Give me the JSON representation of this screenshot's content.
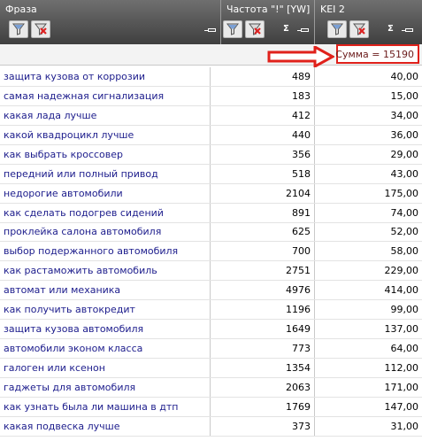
{
  "header": {
    "col_phrase": "Фраза",
    "col_freq": "Частота \"!\" [YW]",
    "col_kei": "KEI 2",
    "sigma": "Σ"
  },
  "summary": {
    "text": "Сумма = 15190"
  },
  "colors": {
    "header_bg": "#4f4f4f",
    "link": "#1c1c8c",
    "highlight": "#e0211b"
  },
  "rows": [
    {
      "phrase": "защита кузова от коррозии",
      "freq": "489",
      "kei": "40,00"
    },
    {
      "phrase": "самая надежная сигнализация",
      "freq": "183",
      "kei": "15,00"
    },
    {
      "phrase": "какая лада лучше",
      "freq": "412",
      "kei": "34,00"
    },
    {
      "phrase": "какой квадроцикл лучше",
      "freq": "440",
      "kei": "36,00"
    },
    {
      "phrase": "как выбрать кроссовер",
      "freq": "356",
      "kei": "29,00"
    },
    {
      "phrase": "передний или полный привод",
      "freq": "518",
      "kei": "43,00"
    },
    {
      "phrase": "недорогие автомобили",
      "freq": "2104",
      "kei": "175,00"
    },
    {
      "phrase": "как сделать подогрев сидений",
      "freq": "891",
      "kei": "74,00"
    },
    {
      "phrase": "проклейка салона автомобиля",
      "freq": "625",
      "kei": "52,00"
    },
    {
      "phrase": "выбор подержанного автомобиля",
      "freq": "700",
      "kei": "58,00"
    },
    {
      "phrase": "как растаможить автомобиль",
      "freq": "2751",
      "kei": "229,00"
    },
    {
      "phrase": "автомат или механика",
      "freq": "4976",
      "kei": "414,00"
    },
    {
      "phrase": "как получить автокредит",
      "freq": "1196",
      "kei": "99,00"
    },
    {
      "phrase": "защита кузова автомобиля",
      "freq": "1649",
      "kei": "137,00"
    },
    {
      "phrase": "автомобили эконом класса",
      "freq": "773",
      "kei": "64,00"
    },
    {
      "phrase": "галоген или ксенон",
      "freq": "1354",
      "kei": "112,00"
    },
    {
      "phrase": "гаджеты для автомобиля",
      "freq": "2063",
      "kei": "171,00"
    },
    {
      "phrase": "как узнать была ли машина в дтп",
      "freq": "1769",
      "kei": "147,00"
    },
    {
      "phrase": "какая подвеска лучше",
      "freq": "373",
      "kei": "31,00"
    }
  ]
}
